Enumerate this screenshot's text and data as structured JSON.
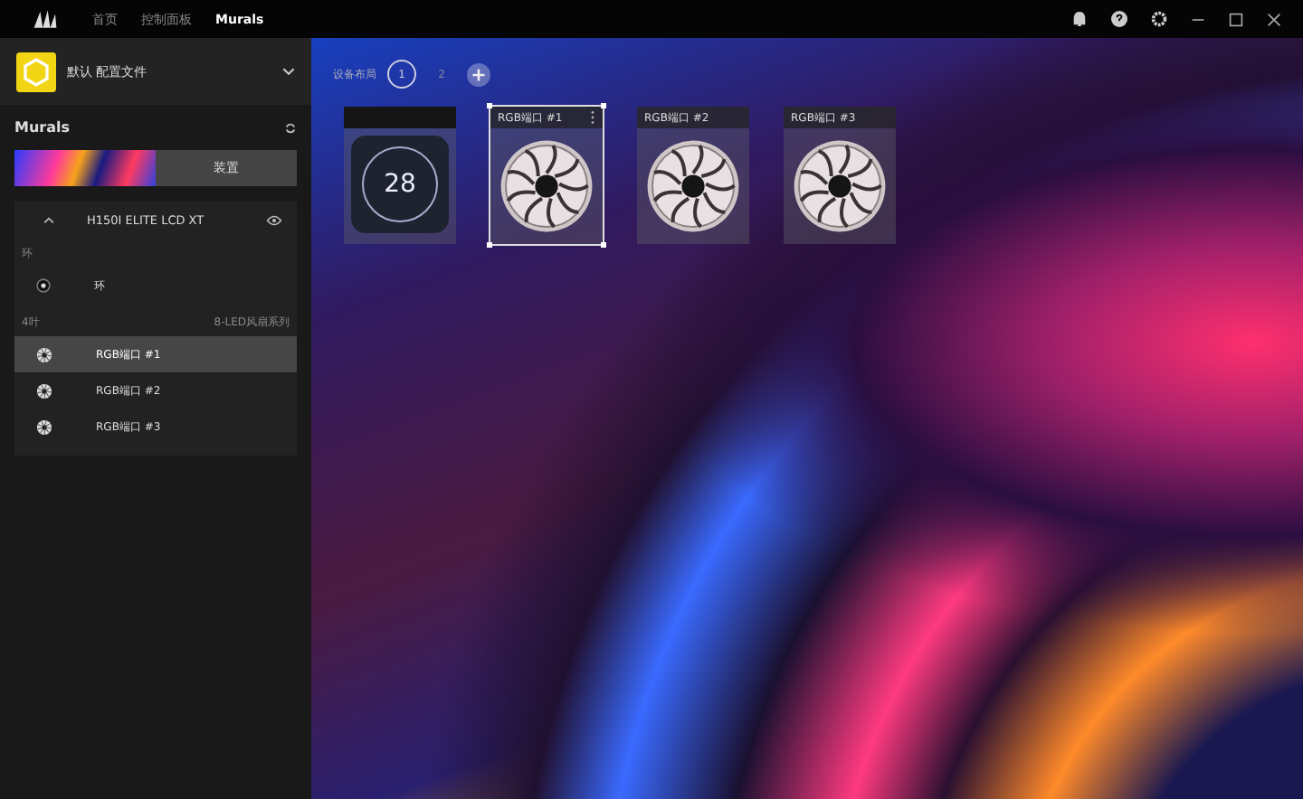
{
  "window": {
    "nav_tabs": [
      {
        "label": "首页",
        "selected": false
      },
      {
        "label": "控制面板",
        "selected": false
      },
      {
        "label": "Murals",
        "selected": true
      }
    ]
  },
  "profile": {
    "name": "默认 配置文件"
  },
  "sidebar": {
    "title": "Murals",
    "apply_button": "装置",
    "device": {
      "name": "H150I ELITE LCD XT",
      "expanded": true,
      "groups": [
        {
          "label": "环",
          "items": [
            {
              "label": "环",
              "kind": "ring",
              "selected": false
            }
          ]
        },
        {
          "label": "4叶",
          "label_right": "8-LED风扇系列",
          "items": [
            {
              "label": "RGB端口 #1",
              "kind": "fan",
              "selected": true
            },
            {
              "label": "RGB端口 #2",
              "kind": "fan",
              "selected": false
            },
            {
              "label": "RGB端口 #3",
              "kind": "fan",
              "selected": false
            }
          ]
        }
      ]
    }
  },
  "canvas": {
    "layout_label": "设备布局",
    "pages": [
      {
        "label": "1",
        "selected": true
      },
      {
        "label": "2",
        "selected": false
      }
    ],
    "devices": [
      {
        "kind": "lcd",
        "reading": "28",
        "selected": false
      },
      {
        "kind": "fan",
        "label": "RGB端口 #1",
        "selected": true
      },
      {
        "kind": "fan",
        "label": "RGB端口 #2",
        "selected": false
      },
      {
        "kind": "fan",
        "label": "RGB端口 #3",
        "selected": false
      }
    ]
  }
}
